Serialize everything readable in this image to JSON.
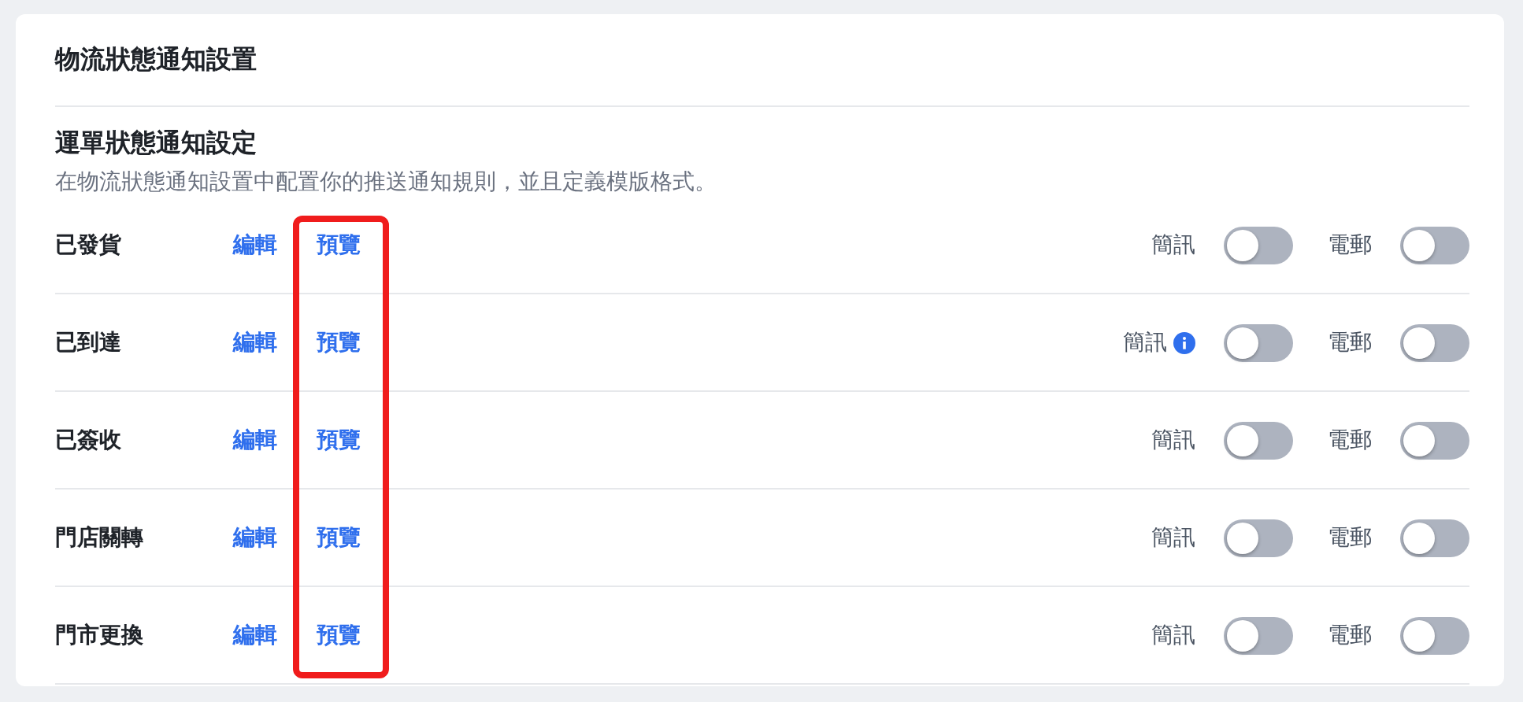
{
  "card": {
    "title": "物流狀態通知設置"
  },
  "section": {
    "heading": "運單狀態通知設定",
    "description": "在物流狀態通知設置中配置你的推送通知規則，並且定義模版格式。"
  },
  "rows": [
    {
      "name": "已發貨",
      "edit": "編輯",
      "preview": "預覽",
      "channels": [
        {
          "label": "簡訊",
          "info": false,
          "on": false
        },
        {
          "label": "電郵",
          "info": false,
          "on": false
        }
      ]
    },
    {
      "name": "已到達",
      "edit": "編輯",
      "preview": "預覽",
      "channels": [
        {
          "label": "簡訊",
          "info": true,
          "on": false
        },
        {
          "label": "電郵",
          "info": false,
          "on": false
        }
      ]
    },
    {
      "name": "已簽收",
      "edit": "編輯",
      "preview": "預覽",
      "channels": [
        {
          "label": "簡訊",
          "info": false,
          "on": false
        },
        {
          "label": "電郵",
          "info": false,
          "on": false
        }
      ]
    },
    {
      "name": "門店關轉",
      "edit": "編輯",
      "preview": "預覽",
      "channels": [
        {
          "label": "簡訊",
          "info": false,
          "on": false
        },
        {
          "label": "電郵",
          "info": false,
          "on": false
        }
      ]
    },
    {
      "name": "門市更換",
      "edit": "編輯",
      "preview": "預覽",
      "channels": [
        {
          "label": "簡訊",
          "info": false,
          "on": false
        },
        {
          "label": "電郵",
          "info": false,
          "on": false
        }
      ]
    }
  ]
}
